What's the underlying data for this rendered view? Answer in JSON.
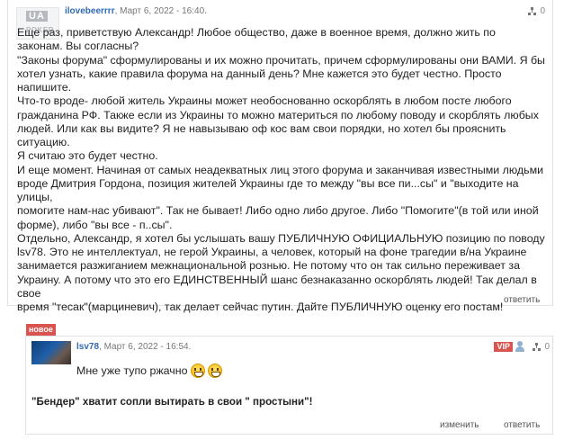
{
  "post1": {
    "avatar_text_top": "UA",
    "avatar_text_bottom": "POKER",
    "author": "ilovebeerrrr",
    "date": ", Март 6, 2022 - 16:40.",
    "rating": "0",
    "body": "Еще раз, приветствую Александр! Любое общество, даже в военное время, должно жить по\nзаконам. Вы согласны?\n\"Законы форума\" сформулированы и их можно прочитать, причем сформулированы они ВАМИ. Я бы\nхотел узнать, какие правила форума на данный день? Мне кажется это будет честно. Просто напишите.\nЧто-то вроде- любой житель Украины может необоснованно оскорблять в любом посте любого\nгражданина РФ. Также если из Украины то можно материться по любому поводу и скорблять любых\nлюдей. Или как вы видите? Я не навызываю оф кос вам свои порядки, но хотел бы прояснить ситуацию.\nЯ считаю это будет честно.\nИ еще момент. Начиная от самых неадекватных лиц этого форума и заканчивая известными людьми\nвроде Дмитрия Гордона, позиция жителей Украины где то между \"вы все пи...сы\" и \"выходите на улицы,\nпомогите нам-нас убивают\". Так не бывает! Либо одно либо другое. Либо \"Помогите\"(в той или иной\nформе), либо \"вы все - п..сы\".\nОтдельно, Александр, я хотел бы услышать вашу  ПУБЛИЧНУЮ ОФИЦИАЛЬНУЮ позицию по поводу\nlsv78. Это не интеллектуал, не герой Украины, а человек, который на фоне трагедии в/на Украине\nзанимается разжиганием межнациональной рознью. Не потому что он так сильно переживает за\nУкраину. А потому что это его ЕДИНСТВЕННЫЙ шанс безнаказанно оскорблять людей! Так делал в свое\nвремя \"тесак\"(марциневич), так делает сейчас путин. Дайте ПУБЛИЧНУЮ оценку его постам!",
    "reply_label": "ответить"
  },
  "post2": {
    "badge": "новое",
    "author": "lsv78",
    "date": ", Март 6, 2022 - 16:54.",
    "vip_label": "VIP",
    "rating": "0",
    "message": "Мне уже тупо ржачно",
    "quote": "\"Бендер\" хватит сопли вытирать в свои \" простыни\"!",
    "edit_label": "изменить",
    "reply_label": "ответить"
  },
  "icons": {
    "tree": "sitemap-icon",
    "user": "user-icon",
    "emoji": "grin-emoji-icon"
  },
  "colors": {
    "author_link": "#2f6bb2",
    "badge_red": "#d9534f",
    "border": "#dfe3e8"
  }
}
